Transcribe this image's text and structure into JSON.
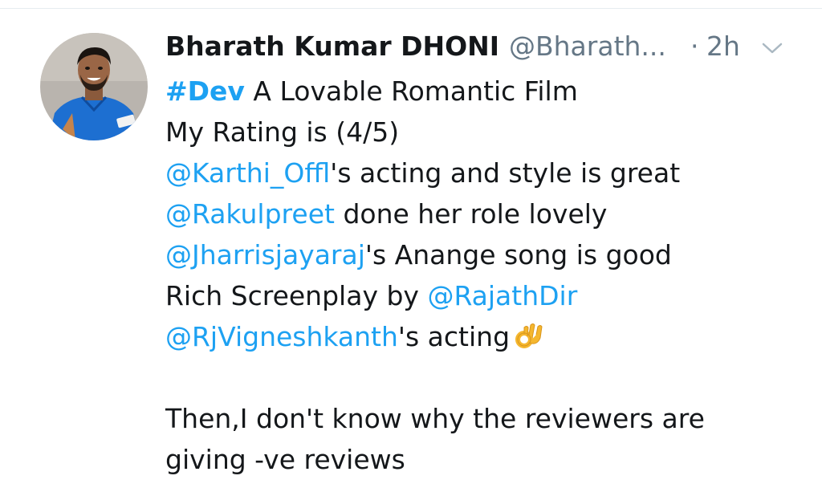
{
  "tweet": {
    "display_name": "Bharath Kumar DHONI",
    "handle": "@Bharath...",
    "separator": "·",
    "time": "2h",
    "hashtag": "#Dev",
    "line1_rest": " A Lovable Romantic Film",
    "line2": "My Rating is (4/5)",
    "line3_mention": "@Karthi_Offl",
    "line3_rest": "'s acting and style is great",
    "line4_mention": "@Rakulpreet",
    "line4_rest": " done her role lovely",
    "line5_mention": "@Jharrisjayaraj",
    "line5_rest": "'s Anange song is good",
    "line6_text": "Rich Screenplay by ",
    "line6_mention": "@RajathDir",
    "line7_mention": "@RjVigneshkanth",
    "line7_rest": "'s acting",
    "line7_emoji": "ok-hand-emoji",
    "line8": "Then,I don't know why the reviewers are",
    "line9": "giving -ve reviews"
  },
  "colors": {
    "link": "#1da1f2",
    "text": "#14171a",
    "secondary": "#657786",
    "jersey": "#1d6fd1"
  },
  "icons": {
    "menu": "chevron-down-icon",
    "avatar": "profile-avatar"
  }
}
